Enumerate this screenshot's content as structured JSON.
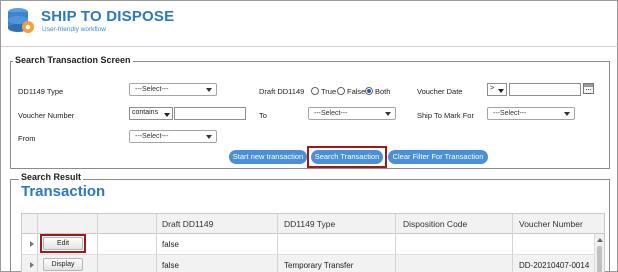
{
  "app": {
    "title": "SHIP TO DISPOSE",
    "subtitle": "User-friendly workflow",
    "brand_color": "#2b78c5"
  },
  "search_screen": {
    "legend": "Search Transaction Screen",
    "fields": {
      "dd1149_type": {
        "label": "DD1149 Type",
        "value": "---Select---"
      },
      "draft_dd1149": {
        "label": "Draft DD1149",
        "options": [
          "True",
          "False",
          "Both"
        ],
        "selected": "Both"
      },
      "voucher_date": {
        "label": "Voucher Date",
        "operator": ">",
        "value": ""
      },
      "voucher_number": {
        "label": "Voucher Number",
        "operator": "contains",
        "value": ""
      },
      "to": {
        "label": "To",
        "value": "---Select---"
      },
      "ship_to_mark_for": {
        "label": "Ship To Mark For",
        "value": "---Select---"
      },
      "from": {
        "label": "From",
        "value": "---Select---"
      }
    },
    "buttons": {
      "start_new": "Start new transaction",
      "search": "Search Transaction",
      "clear_filter": "Clear Filter For Transaction"
    }
  },
  "search_result": {
    "legend": "Search Result",
    "section_title": "Transaction",
    "columns": [
      "",
      "",
      "Draft DD1149",
      "DD1149 Type",
      "Disposition Code",
      "Voucher Number"
    ],
    "rows": [
      {
        "action": "Edit",
        "draft": "false",
        "type": "",
        "disposition": "",
        "voucher": ""
      },
      {
        "action": "Display",
        "draft": "false",
        "type": "Temporary Transfer",
        "disposition": "",
        "voucher": "DD-20210407-0014"
      }
    ]
  },
  "colors": {
    "button_blue": "#4a90d9",
    "highlight_red": "#a01818"
  },
  "icons": [
    "database-icon",
    "gear-icon",
    "calendar-icon",
    "chevron-down-icon",
    "row-expand-icon"
  ]
}
